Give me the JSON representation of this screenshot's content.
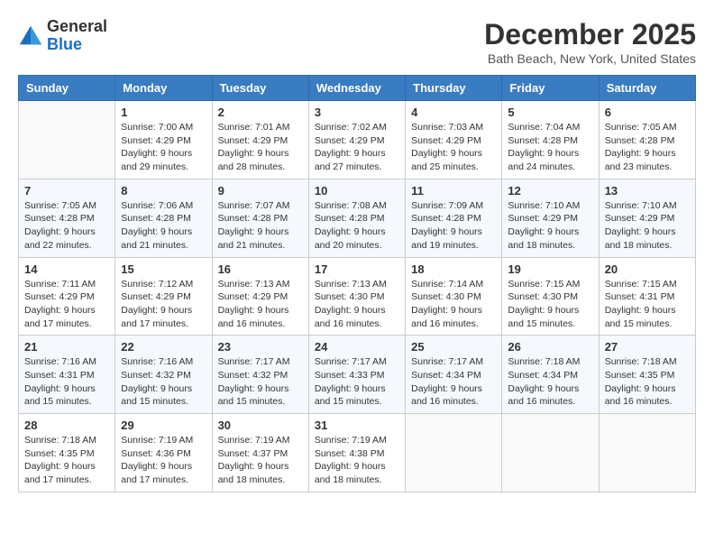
{
  "logo": {
    "general": "General",
    "blue": "Blue"
  },
  "title": "December 2025",
  "location": "Bath Beach, New York, United States",
  "headers": [
    "Sunday",
    "Monday",
    "Tuesday",
    "Wednesday",
    "Thursday",
    "Friday",
    "Saturday"
  ],
  "weeks": [
    [
      {
        "day": "",
        "info": ""
      },
      {
        "day": "1",
        "info": "Sunrise: 7:00 AM\nSunset: 4:29 PM\nDaylight: 9 hours\nand 29 minutes."
      },
      {
        "day": "2",
        "info": "Sunrise: 7:01 AM\nSunset: 4:29 PM\nDaylight: 9 hours\nand 28 minutes."
      },
      {
        "day": "3",
        "info": "Sunrise: 7:02 AM\nSunset: 4:29 PM\nDaylight: 9 hours\nand 27 minutes."
      },
      {
        "day": "4",
        "info": "Sunrise: 7:03 AM\nSunset: 4:29 PM\nDaylight: 9 hours\nand 25 minutes."
      },
      {
        "day": "5",
        "info": "Sunrise: 7:04 AM\nSunset: 4:28 PM\nDaylight: 9 hours\nand 24 minutes."
      },
      {
        "day": "6",
        "info": "Sunrise: 7:05 AM\nSunset: 4:28 PM\nDaylight: 9 hours\nand 23 minutes."
      }
    ],
    [
      {
        "day": "7",
        "info": "Sunrise: 7:05 AM\nSunset: 4:28 PM\nDaylight: 9 hours\nand 22 minutes."
      },
      {
        "day": "8",
        "info": "Sunrise: 7:06 AM\nSunset: 4:28 PM\nDaylight: 9 hours\nand 21 minutes."
      },
      {
        "day": "9",
        "info": "Sunrise: 7:07 AM\nSunset: 4:28 PM\nDaylight: 9 hours\nand 21 minutes."
      },
      {
        "day": "10",
        "info": "Sunrise: 7:08 AM\nSunset: 4:28 PM\nDaylight: 9 hours\nand 20 minutes."
      },
      {
        "day": "11",
        "info": "Sunrise: 7:09 AM\nSunset: 4:28 PM\nDaylight: 9 hours\nand 19 minutes."
      },
      {
        "day": "12",
        "info": "Sunrise: 7:10 AM\nSunset: 4:29 PM\nDaylight: 9 hours\nand 18 minutes."
      },
      {
        "day": "13",
        "info": "Sunrise: 7:10 AM\nSunset: 4:29 PM\nDaylight: 9 hours\nand 18 minutes."
      }
    ],
    [
      {
        "day": "14",
        "info": "Sunrise: 7:11 AM\nSunset: 4:29 PM\nDaylight: 9 hours\nand 17 minutes."
      },
      {
        "day": "15",
        "info": "Sunrise: 7:12 AM\nSunset: 4:29 PM\nDaylight: 9 hours\nand 17 minutes."
      },
      {
        "day": "16",
        "info": "Sunrise: 7:13 AM\nSunset: 4:29 PM\nDaylight: 9 hours\nand 16 minutes."
      },
      {
        "day": "17",
        "info": "Sunrise: 7:13 AM\nSunset: 4:30 PM\nDaylight: 9 hours\nand 16 minutes."
      },
      {
        "day": "18",
        "info": "Sunrise: 7:14 AM\nSunset: 4:30 PM\nDaylight: 9 hours\nand 16 minutes."
      },
      {
        "day": "19",
        "info": "Sunrise: 7:15 AM\nSunset: 4:30 PM\nDaylight: 9 hours\nand 15 minutes."
      },
      {
        "day": "20",
        "info": "Sunrise: 7:15 AM\nSunset: 4:31 PM\nDaylight: 9 hours\nand 15 minutes."
      }
    ],
    [
      {
        "day": "21",
        "info": "Sunrise: 7:16 AM\nSunset: 4:31 PM\nDaylight: 9 hours\nand 15 minutes."
      },
      {
        "day": "22",
        "info": "Sunrise: 7:16 AM\nSunset: 4:32 PM\nDaylight: 9 hours\nand 15 minutes."
      },
      {
        "day": "23",
        "info": "Sunrise: 7:17 AM\nSunset: 4:32 PM\nDaylight: 9 hours\nand 15 minutes."
      },
      {
        "day": "24",
        "info": "Sunrise: 7:17 AM\nSunset: 4:33 PM\nDaylight: 9 hours\nand 15 minutes."
      },
      {
        "day": "25",
        "info": "Sunrise: 7:17 AM\nSunset: 4:34 PM\nDaylight: 9 hours\nand 16 minutes."
      },
      {
        "day": "26",
        "info": "Sunrise: 7:18 AM\nSunset: 4:34 PM\nDaylight: 9 hours\nand 16 minutes."
      },
      {
        "day": "27",
        "info": "Sunrise: 7:18 AM\nSunset: 4:35 PM\nDaylight: 9 hours\nand 16 minutes."
      }
    ],
    [
      {
        "day": "28",
        "info": "Sunrise: 7:18 AM\nSunset: 4:35 PM\nDaylight: 9 hours\nand 17 minutes."
      },
      {
        "day": "29",
        "info": "Sunrise: 7:19 AM\nSunset: 4:36 PM\nDaylight: 9 hours\nand 17 minutes."
      },
      {
        "day": "30",
        "info": "Sunrise: 7:19 AM\nSunset: 4:37 PM\nDaylight: 9 hours\nand 18 minutes."
      },
      {
        "day": "31",
        "info": "Sunrise: 7:19 AM\nSunset: 4:38 PM\nDaylight: 9 hours\nand 18 minutes."
      },
      {
        "day": "",
        "info": ""
      },
      {
        "day": "",
        "info": ""
      },
      {
        "day": "",
        "info": ""
      }
    ]
  ]
}
